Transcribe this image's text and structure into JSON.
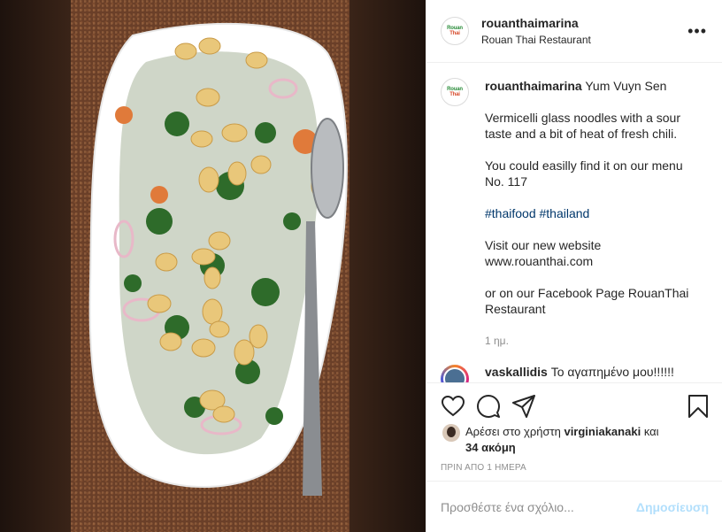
{
  "header": {
    "username": "rouanthaimarina",
    "subtitle": "Rouan Thai Restaurant"
  },
  "caption": {
    "username": "rouanthaimarina",
    "title": "Yum Vuyn Sen",
    "line1": "Vermicelli glass noodles with a sour taste and a bit of heat of fresh chili.",
    "line2": "You could easilly find it on our menu No. 117",
    "hashtag1": "#thaifood",
    "hashtag2": "#thailand",
    "line4": "Visit our new website www.rouanthai.com",
    "line5": "or on our Facebook Page RouanThai Restaurant",
    "time": "1 ημ."
  },
  "comment": {
    "username": "vaskallidis",
    "text": "Το αγαπημένο μου!!!!!!"
  },
  "likes": {
    "prefix": "Αρέσει στο χρήστη",
    "user": "virginiakanaki",
    "middle": "και",
    "others": "34 ακόμη"
  },
  "date": "ΠΡΙΝ ΑΠΟ 1 ΗΜΕΡΑ",
  "add_comment": {
    "placeholder": "Προσθέστε ένα σχόλιο...",
    "post_label": "Δημοσίευση"
  },
  "icons": {
    "more": "more-options-icon",
    "like": "heart-icon",
    "comment": "comment-icon",
    "share": "share-icon",
    "save": "bookmark-icon"
  }
}
